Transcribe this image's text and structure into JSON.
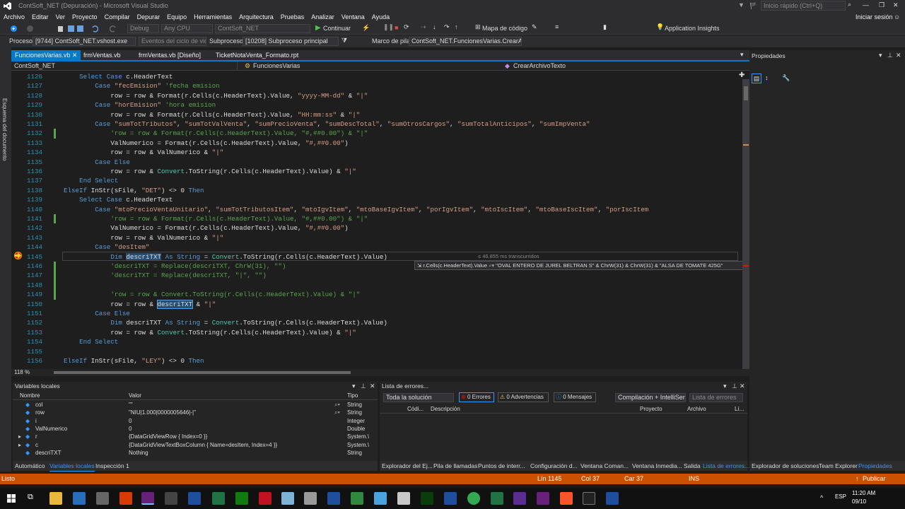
{
  "window": {
    "title": "ContSoft_NET (Depuración) - Microsoft Visual Studio",
    "quick_launch": "Inicio rápido (Ctrl+Q)",
    "sign_in": "Iniciar sesión"
  },
  "menu": [
    "Archivo",
    "Editar",
    "Ver",
    "Proyecto",
    "Compilar",
    "Depurar",
    "Equipo",
    "Herramientas",
    "Arquitectura",
    "Pruebas",
    "Analizar",
    "Ventana",
    "Ayuda"
  ],
  "toolbar1": {
    "config": "Debug",
    "platform": "Any CPU",
    "project": "ContSoft_NET",
    "continue_label": "Continuar",
    "code_map": "Mapa de código",
    "app_insights": "Application Insights"
  },
  "toolbar2": {
    "process_label": "Proceso:",
    "process_value": "[9744] ContSoft_NET.vshost.exe",
    "lifecycle": "Eventos del ciclo de vida",
    "thread_label": "Subproceso:",
    "thread_value": "[10208] Subproceso principal",
    "stack_label": "Marco de pila:",
    "stack_value": "ContSoft_NET.FuncionesVarias.CrearArchi"
  },
  "doc_outline": "Esquema del documento",
  "tabs": [
    "FuncionesVarias.vb",
    "frmVentas.vb",
    "frmVentas.vb [Diseño]",
    "TicketNotaVenta_Formato.rpt"
  ],
  "navbar": {
    "project": "ContSoft_NET",
    "class": "FuncionesVarias",
    "method": "CrearArchivoTexto"
  },
  "code_lines": [
    {
      "n": "1126",
      "i": 12,
      "t": [
        [
          "kw",
          "Select Case "
        ],
        [
          "",
          "c.HeaderText"
        ]
      ]
    },
    {
      "n": "1127",
      "i": 16,
      "t": [
        [
          "kw",
          "Case "
        ],
        [
          "str",
          "\"fecEmision\""
        ],
        [
          "",
          ""
        ],
        [
          "cm",
          " 'fecha emision"
        ]
      ]
    },
    {
      "n": "1128",
      "i": 20,
      "t": [
        [
          "",
          "row = row & Format(r.Cells(c.HeaderText).Value, "
        ],
        [
          "str",
          "\"yyyy-MM-dd\""
        ],
        [
          "",
          " & "
        ],
        [
          "str",
          "\"|\""
        ]
      ]
    },
    {
      "n": "1129",
      "i": 16,
      "t": [
        [
          "kw",
          "Case "
        ],
        [
          "str",
          "\"horEmision\""
        ],
        [
          "cm",
          " 'hora emision"
        ]
      ]
    },
    {
      "n": "1130",
      "i": 20,
      "t": [
        [
          "",
          "row = row & Format(r.Cells(c.HeaderText).Value, "
        ],
        [
          "str",
          "\"HH:mm:ss\""
        ],
        [
          "",
          " & "
        ],
        [
          "str",
          "\"|\""
        ]
      ]
    },
    {
      "n": "1131",
      "i": 16,
      "t": [
        [
          "kw",
          "Case "
        ],
        [
          "str",
          "\"sumTotTributos\""
        ],
        [
          "",
          ", "
        ],
        [
          "str",
          "\"sumTotValVenta\""
        ],
        [
          "",
          ", "
        ],
        [
          "str",
          "\"sumPrecioVenta\""
        ],
        [
          "",
          ", "
        ],
        [
          "str",
          "\"sumDescTotal\""
        ],
        [
          "",
          ", "
        ],
        [
          "str",
          "\"sumOtrosCargos\""
        ],
        [
          "",
          ", "
        ],
        [
          "str",
          "\"sumTotalAnticipos\""
        ],
        [
          "",
          ", "
        ],
        [
          "str",
          "\"sumImpVenta\""
        ]
      ]
    },
    {
      "n": "1132",
      "i": 20,
      "t": [
        [
          "cm",
          "'row = row & Format(r.Cells(c.HeaderText).Value, \"#,##0.00\") & \"|\""
        ]
      ]
    },
    {
      "n": "1133",
      "i": 20,
      "t": [
        [
          "",
          "ValNumerico = Format(r.Cells(c.HeaderText).Value, "
        ],
        [
          "str",
          "\"#,##0.00\""
        ],
        [
          "",
          ")"
        ]
      ]
    },
    {
      "n": "1134",
      "i": 20,
      "t": [
        [
          "",
          "row = row & ValNumerico & "
        ],
        [
          "str",
          "\"|\""
        ]
      ]
    },
    {
      "n": "1135",
      "i": 16,
      "t": [
        [
          "kw",
          "Case Else"
        ]
      ]
    },
    {
      "n": "1136",
      "i": 20,
      "t": [
        [
          "",
          "row = row & "
        ],
        [
          "ty",
          "Convert"
        ],
        [
          "",
          ".ToString(r.Cells(c.HeaderText).Value) & "
        ],
        [
          "str",
          "\"|\""
        ]
      ]
    },
    {
      "n": "1137",
      "i": 12,
      "t": [
        [
          "kw",
          "End Select"
        ]
      ]
    },
    {
      "n": "1138",
      "i": 8,
      "t": [
        [
          "kw",
          "ElseIf "
        ],
        [
          "",
          "InStr(sFile, "
        ],
        [
          "str",
          "\"DET\""
        ],
        [
          "",
          ") <> 0 "
        ],
        [
          "kw",
          "Then"
        ]
      ]
    },
    {
      "n": "1139",
      "i": 12,
      "t": [
        [
          "kw",
          "Select Case "
        ],
        [
          "",
          "c.HeaderText"
        ]
      ]
    },
    {
      "n": "1140",
      "i": 16,
      "t": [
        [
          "kw",
          "Case "
        ],
        [
          "str",
          "\"mtoPrecioVentaUnitario\""
        ],
        [
          "",
          ", "
        ],
        [
          "str",
          "\"sumTotTributosItem\""
        ],
        [
          "",
          ", "
        ],
        [
          "str",
          "\"mtoIgvItem\""
        ],
        [
          "",
          ", "
        ],
        [
          "str",
          "\"mtoBaseIgvItem\""
        ],
        [
          "",
          ", "
        ],
        [
          "str",
          "\"porIgvItem\""
        ],
        [
          "",
          ", "
        ],
        [
          "str",
          "\"mtoIscItem\""
        ],
        [
          "",
          ", "
        ],
        [
          "str",
          "\"mtoBaseIscItem\""
        ],
        [
          "",
          ", "
        ],
        [
          "str",
          "\"porIscItem"
        ]
      ]
    },
    {
      "n": "1141",
      "i": 20,
      "t": [
        [
          "cm",
          "'row = row & Format(r.Cells(c.HeaderText).Value, \"#,##0.00\") & \"|\""
        ]
      ]
    },
    {
      "n": "1142",
      "i": 20,
      "t": [
        [
          "",
          "ValNumerico = Format(r.Cells(c.HeaderText).Value, "
        ],
        [
          "str",
          "\"#,##0.00\""
        ],
        [
          "",
          ")"
        ]
      ]
    },
    {
      "n": "1143",
      "i": 20,
      "t": [
        [
          "",
          "row = row & ValNumerico & "
        ],
        [
          "str",
          "\"|\""
        ]
      ]
    },
    {
      "n": "1144",
      "i": 16,
      "t": [
        [
          "kw",
          "Case "
        ],
        [
          "str",
          "\"desItem\""
        ]
      ]
    },
    {
      "n": "1145",
      "i": 20,
      "t": [
        [
          "kw",
          "Dim "
        ],
        [
          "hl",
          "descriTXT"
        ],
        [
          "",
          " "
        ],
        [
          "kw",
          "As String"
        ],
        [
          "",
          " = "
        ],
        [
          "ty",
          "Convert"
        ],
        [
          "",
          ".ToString(r.Cells(c.HeaderText).Value)"
        ]
      ]
    },
    {
      "n": "1146",
      "i": 20,
      "t": [
        [
          "cm",
          "'descriTXT = Replace(descriTXT, ChrW(31), \"\")"
        ]
      ]
    },
    {
      "n": "1147",
      "i": 20,
      "t": [
        [
          "cm",
          "'descriTXT = Replace(descriTXT, \"|\", \"\")"
        ]
      ]
    },
    {
      "n": "1148",
      "i": 20,
      "t": [
        [
          "",
          ""
        ]
      ]
    },
    {
      "n": "1149",
      "i": 20,
      "t": [
        [
          "cm",
          "'row = row & Convert.ToString(r.Cells(c.HeaderText).Value) & \"|\""
        ]
      ]
    },
    {
      "n": "1150",
      "i": 20,
      "t": [
        [
          "",
          "row = row & "
        ],
        [
          "hlbox",
          "descriTXT"
        ],
        [
          "",
          " & "
        ],
        [
          "str",
          "\"|\""
        ]
      ]
    },
    {
      "n": "1151",
      "i": 16,
      "t": [
        [
          "kw",
          "Case Else"
        ]
      ]
    },
    {
      "n": "1152",
      "i": 20,
      "t": [
        [
          "kw",
          "Dim "
        ],
        [
          "",
          "descriTXT "
        ],
        [
          "kw",
          "As String"
        ],
        [
          "",
          " = "
        ],
        [
          "ty",
          "Convert"
        ],
        [
          "",
          ".ToString(r.Cells(c.HeaderText).Value)"
        ]
      ]
    },
    {
      "n": "1153",
      "i": 20,
      "t": [
        [
          "",
          "row = row & "
        ],
        [
          "ty",
          "Convert"
        ],
        [
          "",
          ".ToString(r.Cells(c.HeaderText).Value) & "
        ],
        [
          "str",
          "\"|\""
        ]
      ]
    },
    {
      "n": "1154",
      "i": 12,
      "t": [
        [
          "kw",
          "End Select"
        ]
      ]
    },
    {
      "n": "1155",
      "i": 8,
      "t": [
        [
          "",
          ""
        ]
      ]
    },
    {
      "n": "1156",
      "i": 8,
      "t": [
        [
          "kw",
          "ElseIf "
        ],
        [
          "",
          "InStr(sFile, "
        ],
        [
          "str",
          "\"LEY\""
        ],
        [
          "",
          ") <> 0 "
        ],
        [
          "kw",
          "Then"
        ]
      ]
    }
  ],
  "perf_tip": "≤ 46.855 ms transcurridos",
  "datatip": {
    "expr": "r.Cells(c.HeaderText).Value",
    "value": "\"OVAL ENTERO DE JUREL BELTRAN S\" & ChrW(31) & ChrW(31) & \"ALSA DE TOMATE 425G\""
  },
  "zoom": "118 %",
  "locals": {
    "title": "Variables locales",
    "headers": [
      "Nombre",
      "Valor",
      "Tipo"
    ],
    "rows": [
      [
        "col",
        "\"\"",
        "String"
      ],
      [
        "row",
        "\"NIU|1.000|0000005646|-|\"",
        "String"
      ],
      [
        "i",
        "0",
        "Integer"
      ],
      [
        "ValNumerico",
        "0",
        "Double"
      ],
      [
        "r",
        "{DataGridViewRow { Index=0 }}",
        "System.\\"
      ],
      [
        "c",
        "{DataGridViewTextBoxColumn { Name=desItem, Index=4 }}",
        "System.\\"
      ],
      [
        "descriTXT",
        "Nothing",
        "String"
      ]
    ]
  },
  "bottom_tabs_left": [
    "Automático",
    "Variables locales",
    "Inspección 1"
  ],
  "errors": {
    "title": "Lista de errores...",
    "scope": "Toda la solución",
    "errors": "0 Errores",
    "warnings": "0 Advertencias",
    "messages": "0 Mensajes",
    "build": "Compilación + IntelliSen",
    "search": "Lista de errores",
    "headers": [
      "Códi...",
      "Descripción",
      "Proyecto",
      "Archivo",
      "Lí..."
    ]
  },
  "bottom_tabs_right": [
    "Explorador del Ej...",
    "Pila de llamadas",
    "Puntos de interr...",
    "Configuración d...",
    "Ventana Coman...",
    "Ventana Inmedia...",
    "Salida",
    "Lista de errores..."
  ],
  "props": {
    "title": "Propiedades",
    "tabs": [
      "Explorador de soluciones",
      "Team Explorer",
      "Propiedades"
    ]
  },
  "status": {
    "ready": "Listo",
    "line": "Lín 1145",
    "col": "Col 37",
    "car": "Car 37",
    "ins": "INS",
    "publish": "Publicar"
  },
  "taskbar": {
    "lang": "ESP",
    "time": "11:20 AM",
    "date": "09/10"
  },
  "colors": {
    "accent": "#007acc",
    "status": "#ca5100"
  }
}
